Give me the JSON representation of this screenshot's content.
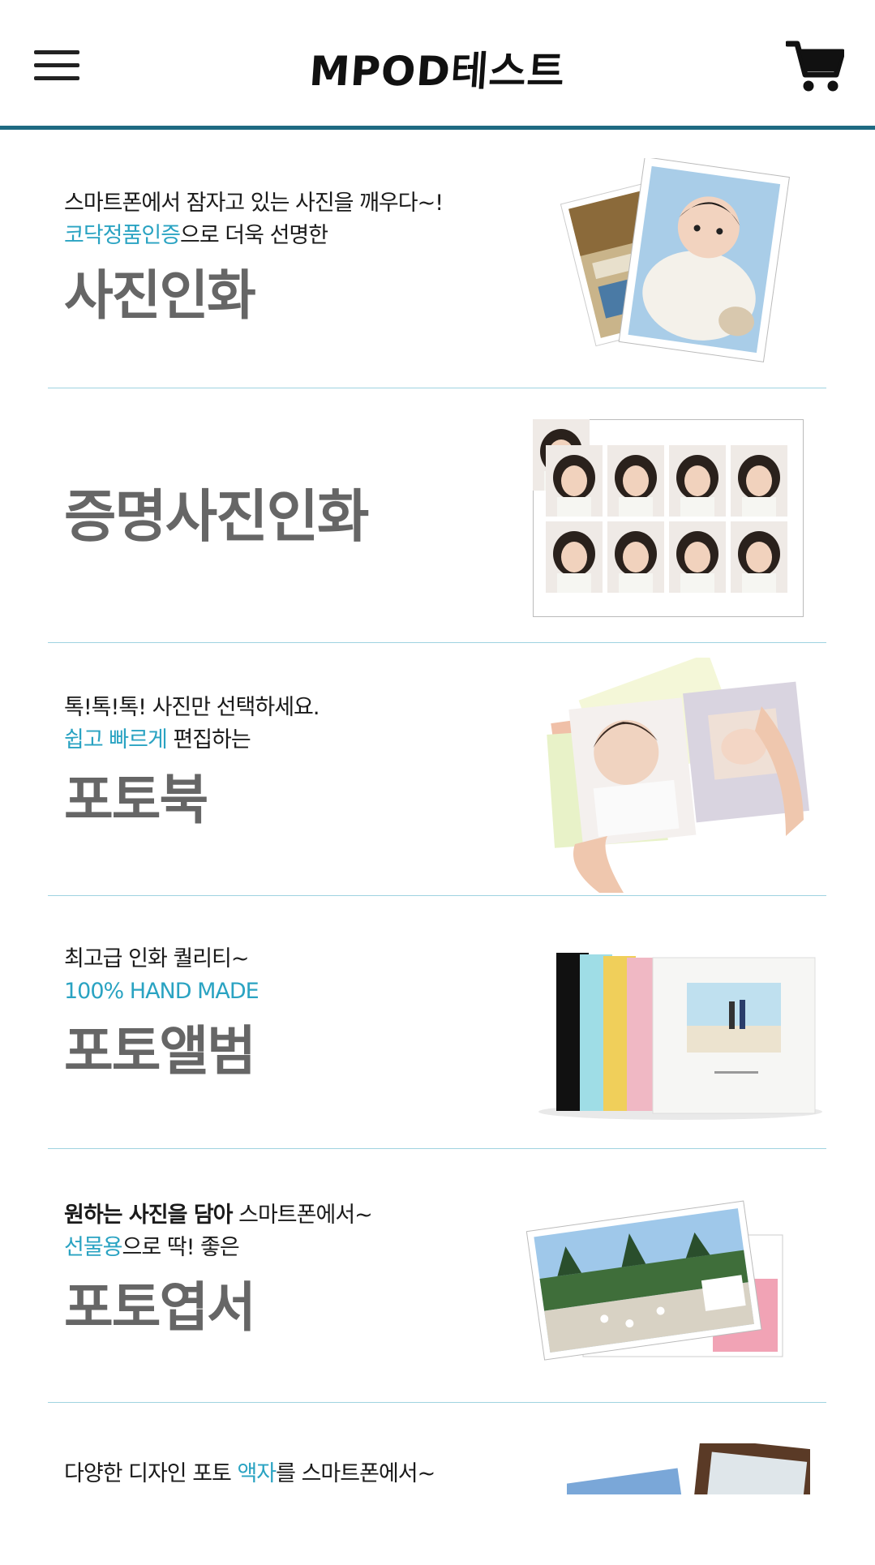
{
  "header": {
    "logo": "MPOD테스트",
    "menu_icon": "hamburger-icon",
    "cart_icon": "cart-icon"
  },
  "colors": {
    "accent": "#2aa3c2",
    "header_border": "#1e6a82",
    "divider": "#9fd3e0",
    "title": "#666666"
  },
  "items": [
    {
      "line1": "스마트폰에서 잠자고 있는 사진을 깨우다~!",
      "line2_hl": "코닥정품인증",
      "line2_rest": "으로 더욱 선명한",
      "title": "사진인화"
    },
    {
      "title": "증명사진인화"
    },
    {
      "line1": "톡!톡!톡! 사진만 선택하세요.",
      "line2_hl": "쉽고 빠르게",
      "line2_rest": " 편집하는",
      "title": "포토북"
    },
    {
      "line1": "최고급 인화 퀄리티~",
      "line2_hl": "100% HAND MADE",
      "line2_rest": "",
      "title": "포토앨범"
    },
    {
      "line1_bold": "원하는 사진을 담아",
      "line1_rest": " 스마트폰에서~",
      "line2_hl": "선물용",
      "line2_rest": "으로 딱! 좋은",
      "title": "포토엽서"
    },
    {
      "line1_a": "다양한 디자인 포토 ",
      "line1_hl": "액자",
      "line1_b": "를 스마트폰에서~"
    }
  ]
}
